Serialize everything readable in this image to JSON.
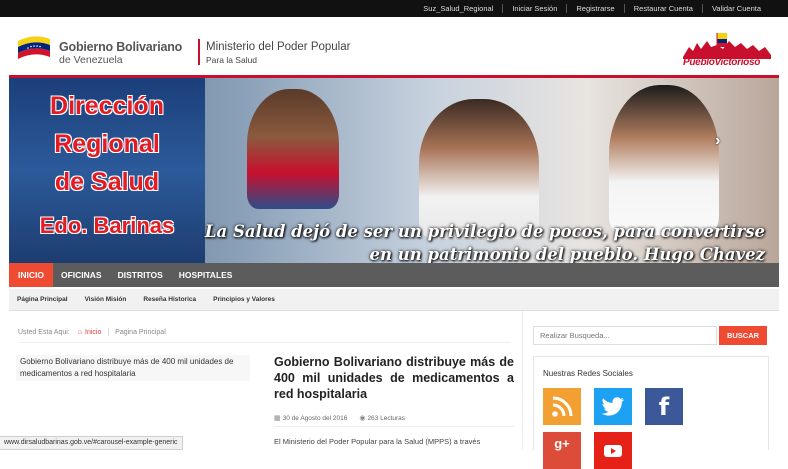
{
  "topbar": {
    "links": [
      "Suz_Salud_Regional",
      "Iniciar Sesión",
      "Registrarse",
      "Restaurar Cuenta",
      "Validar Cuenta"
    ]
  },
  "header": {
    "gob_line1": "Gobierno Bolivariano",
    "gob_line2": "de Venezuela",
    "ministry_line1": "Ministerio del Poder Popular",
    "ministry_line2": "Para la Salud",
    "right_logo_text": "PuebloVictorioso"
  },
  "banner": {
    "title_lines": [
      "Dirección",
      "Regional",
      "de Salud",
      "Edo. Barinas"
    ],
    "quote_line1": "La Salud dejó de ser un privilegio de pocos, para convertirse",
    "quote_line2": "en un patrimonio del pueblo. Hugo Chavez",
    "next_arrow": "›"
  },
  "mainnav": {
    "items": [
      "INICIO",
      "OFICINAS",
      "DISTRITOS",
      "HOSPITALES"
    ],
    "active_index": 0
  },
  "subnav": {
    "items": [
      "Página Principal",
      "Visión Misión",
      "Reseña Historica",
      "Principios y Valores"
    ]
  },
  "breadcrumb": {
    "prefix": "Usted Esta Aqui:",
    "home": "Inicio",
    "current": "Pagina Principal"
  },
  "slide_caption": "Gobierno Bolivariano distribuye más de 400 mil unidades de medicamentos a red hospitalaria",
  "article": {
    "title": "Gobierno Bolivariano distribuye más de 400 mil unidades de medicamentos a red hospitalaria",
    "date": "30 de Agosto del 2016",
    "views": "263 Lecturas",
    "body_start": "El Ministerio del Poder Popular para la Salud (MPPS) a través"
  },
  "status_url": "www.dirsaludbarinas.gob.ve/#carousel-example-generic",
  "sidebar": {
    "search_placeholder": "Realizar Busqueda...",
    "search_button": "BUSCAR",
    "social_title": "Nuestras Redes Sociales",
    "social_icons": [
      "rss-icon",
      "twitter-icon",
      "facebook-icon",
      "google-plus-icon",
      "youtube-icon"
    ],
    "gplus_label": "g+",
    "fb_label": "f"
  },
  "colors": {
    "accent": "#ef4a32",
    "nav_bg": "#5c5c5c",
    "brand_red": "#c8102e",
    "topbar": "#111111"
  }
}
